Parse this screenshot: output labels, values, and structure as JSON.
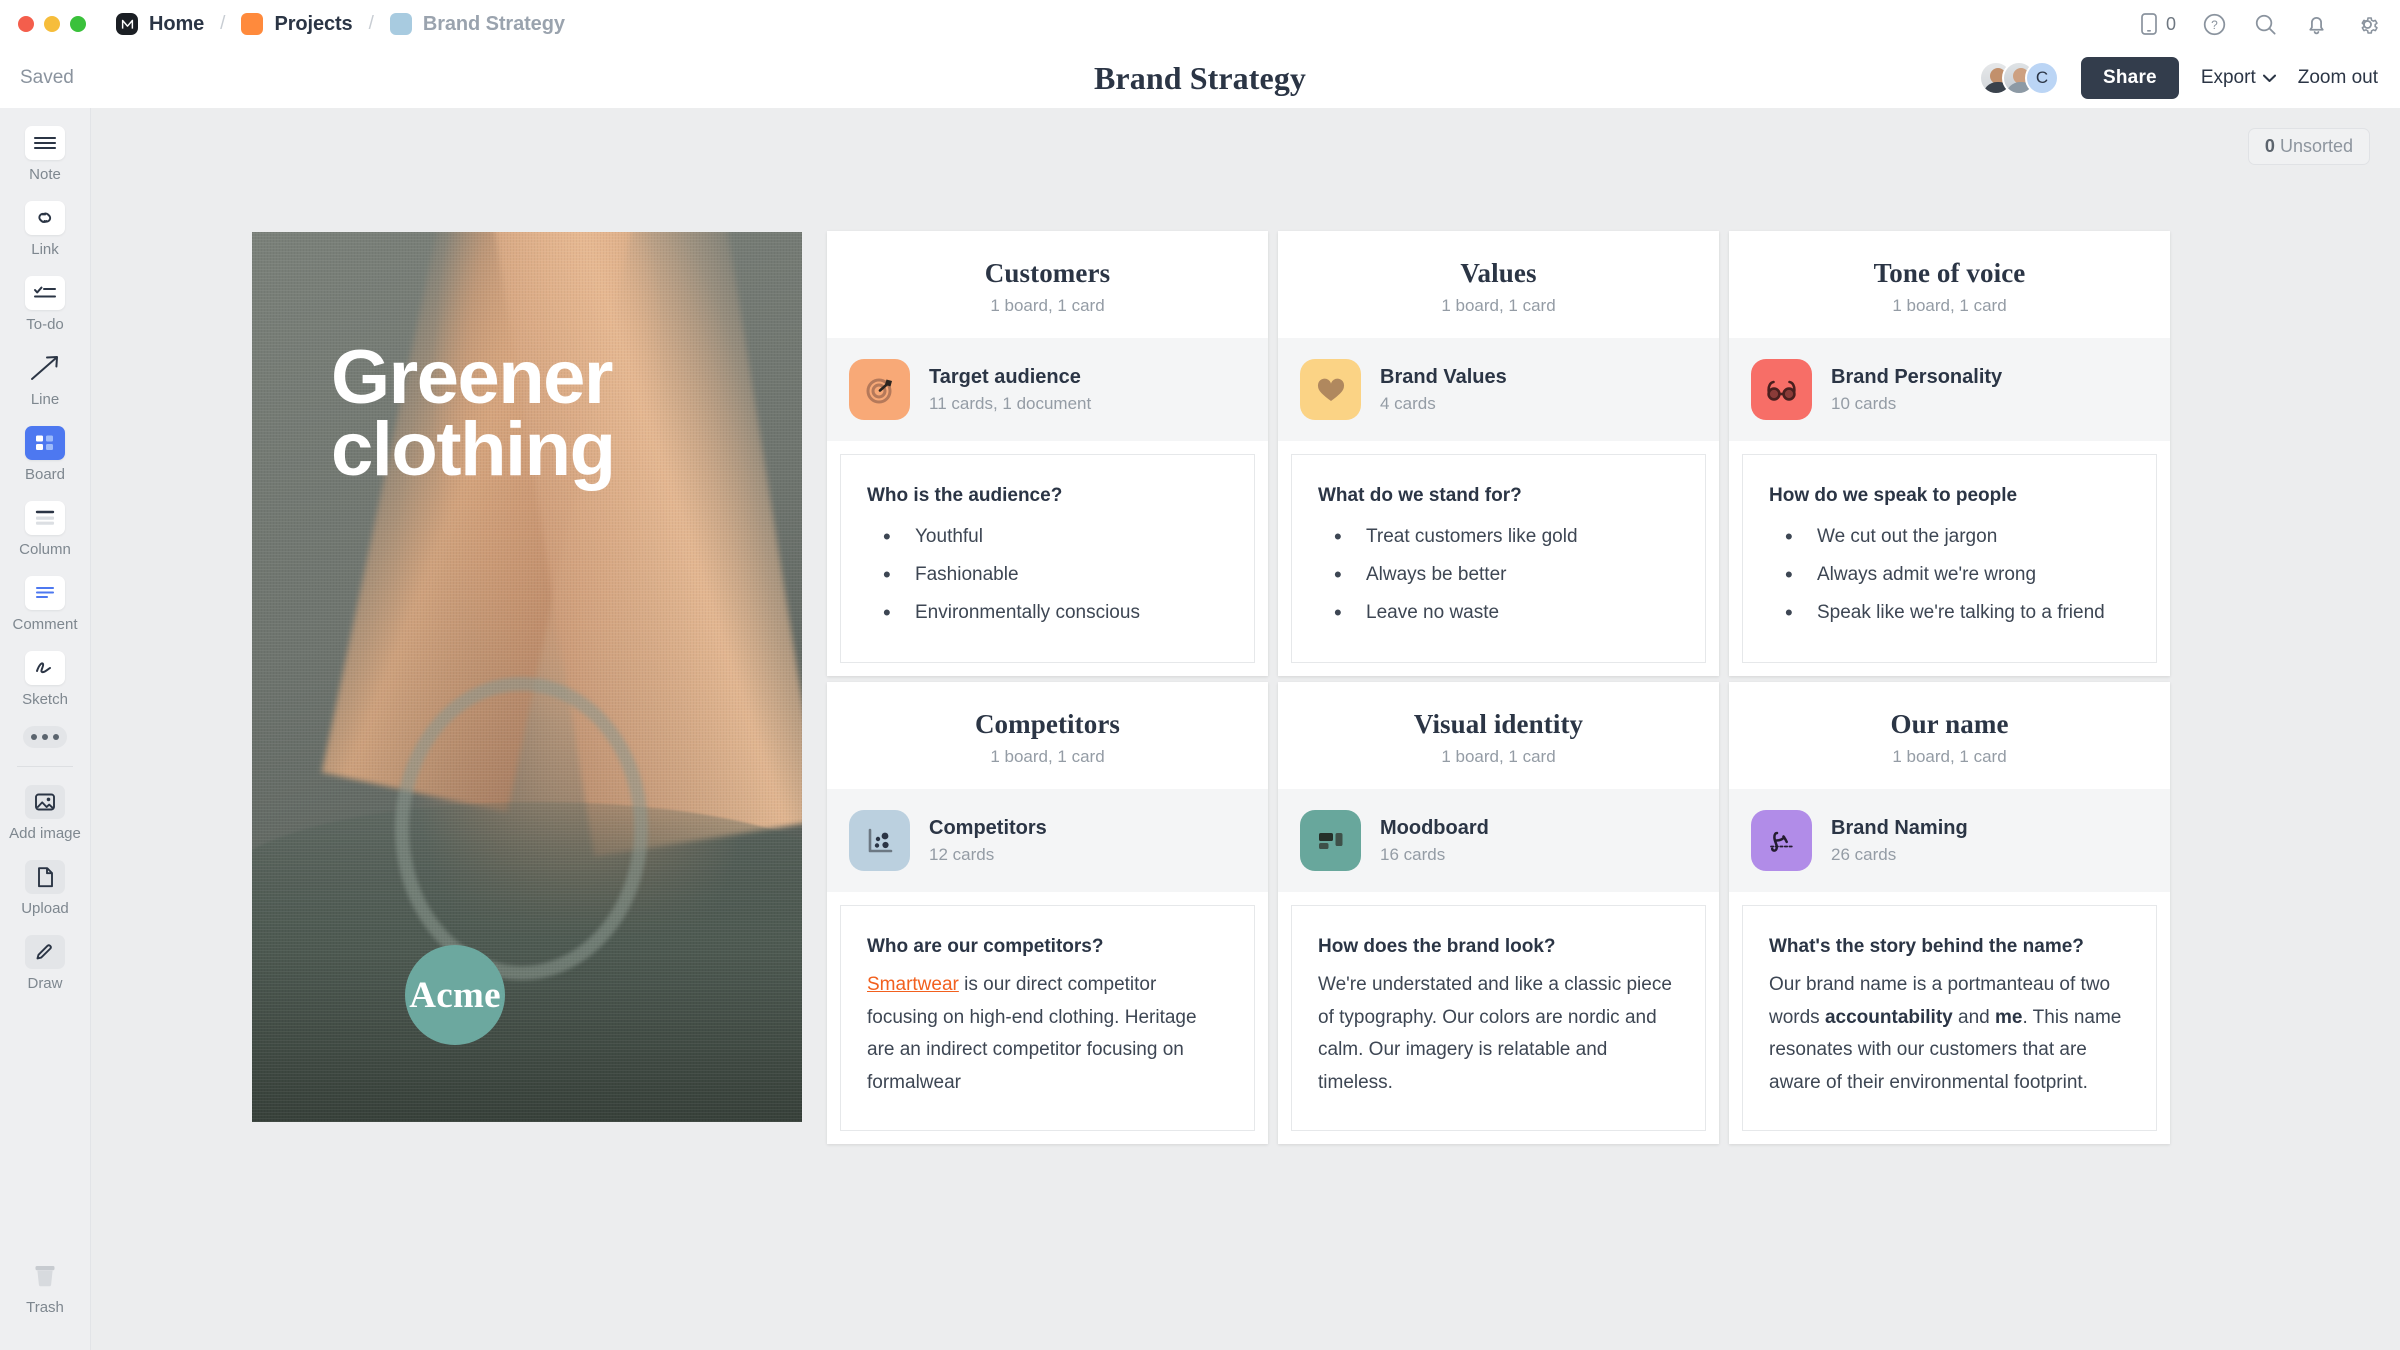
{
  "window": {
    "traffic_lights": [
      "close-red",
      "minimize-yellow",
      "maximize-green"
    ],
    "breadcrumb": [
      {
        "label": "Home",
        "icon": "milanote-logo-icon",
        "muted": false
      },
      {
        "label": "Projects",
        "icon": "orange-folder-icon",
        "muted": false
      },
      {
        "label": "Brand Strategy",
        "icon": "blue-board-icon",
        "muted": true
      }
    ],
    "separator": "/"
  },
  "topbar_icons": {
    "device_count": "0",
    "device": "mobile-device-icon",
    "help": "help-circle-icon",
    "search": "search-icon",
    "notifications": "bell-icon",
    "settings": "gear-icon"
  },
  "subbar": {
    "save_status": "Saved",
    "title": "Brand Strategy",
    "avatars": [
      "user-avatar-1",
      "user-avatar-2",
      "C"
    ],
    "share_label": "Share",
    "export_label": "Export",
    "export_caret": "chevron-down-icon",
    "zoom_label": "Zoom out"
  },
  "toolbar": {
    "items": [
      {
        "label": "Note",
        "icon": "note-icon",
        "style": "white"
      },
      {
        "label": "Link",
        "icon": "link-icon",
        "style": "white"
      },
      {
        "label": "To-do",
        "icon": "todo-icon",
        "style": "white"
      },
      {
        "label": "Line",
        "icon": "line-arrow-icon",
        "style": "plain"
      },
      {
        "label": "Board",
        "icon": "board-icon",
        "style": "active"
      },
      {
        "label": "Column",
        "icon": "column-icon",
        "style": "white"
      },
      {
        "label": "Comment",
        "icon": "comment-icon",
        "style": "white"
      },
      {
        "label": "Sketch",
        "icon": "sketch-icon",
        "style": "white"
      }
    ],
    "more": "more-dots-icon",
    "secondary": [
      {
        "label": "Add image",
        "icon": "add-image-icon"
      },
      {
        "label": "Upload",
        "icon": "upload-file-icon"
      },
      {
        "label": "Draw",
        "icon": "draw-pencil-icon"
      }
    ],
    "trash": {
      "label": "Trash",
      "icon": "trash-icon"
    }
  },
  "canvas": {
    "unsorted_count": "0",
    "unsorted_label": "Unsorted"
  },
  "hero": {
    "headline_line1": "Greener",
    "headline_line2": "clothing",
    "badge": "Acme",
    "badge_color": "#6CA89F"
  },
  "cards": [
    {
      "title": "Customers",
      "subtitle": "1 board, 1 card",
      "board": {
        "name": "Target audience",
        "meta": "11 cards, 1 document",
        "icon": "target-dartboard-icon",
        "color": "#F8A977"
      },
      "note": {
        "heading": "Who is the audience?",
        "type": "list",
        "items": [
          "Youthful",
          "Fashionable",
          "Environmentally conscious"
        ]
      }
    },
    {
      "title": "Values",
      "subtitle": "1 board, 1 card",
      "board": {
        "name": "Brand Values",
        "meta": "4 cards",
        "icon": "heart-icon",
        "color": "#FBD385"
      },
      "note": {
        "heading": "What do we stand for?",
        "type": "list",
        "items": [
          "Treat customers like gold",
          "Always be better",
          "Leave no waste"
        ]
      }
    },
    {
      "title": "Tone of voice",
      "subtitle": "1 board, 1 card",
      "board": {
        "name": "Brand Personality",
        "meta": "10 cards",
        "icon": "glasses-icon",
        "color": "#F76E67"
      },
      "note": {
        "heading": "How do we speak to people",
        "type": "list",
        "items": [
          "We cut out the jargon",
          "Always admit we're wrong",
          "Speak like we're talking to a friend"
        ]
      }
    },
    {
      "title": "Competitors",
      "subtitle": "1 board, 1 card",
      "board": {
        "name": "Competitors",
        "meta": "12 cards",
        "icon": "scatter-plot-icon",
        "color": "#BBD0DF"
      },
      "note": {
        "heading": "Who are our competitors?",
        "type": "paragraph",
        "link_text": "Smartwear",
        "body": " is our direct competitor focusing on high-end clothing. Heritage are an indirect competitor focusing on formalwear"
      }
    },
    {
      "title": "Visual identity",
      "subtitle": "1 board, 1 card",
      "board": {
        "name": "Moodboard",
        "meta": "16 cards",
        "icon": "moodboard-layout-icon",
        "color": "#68A79C"
      },
      "note": {
        "heading": "How does the brand look?",
        "type": "paragraph",
        "body": "We're understated and like a classic piece of typography. Our colors are nordic and calm. Our imagery is relatable and timeless."
      }
    },
    {
      "title": "Our name",
      "subtitle": "1 board, 1 card",
      "board": {
        "name": "Brand Naming",
        "meta": "26 cards",
        "icon": "signature-icon",
        "color": "#B18CE8"
      },
      "note": {
        "heading": "What's the story behind the name?",
        "type": "rich",
        "parts": [
          {
            "text": "Our brand name is a portmanteau of two words ",
            "bold": false
          },
          {
            "text": "accountability",
            "bold": true
          },
          {
            "text": " and ",
            "bold": false
          },
          {
            "text": "me",
            "bold": true
          },
          {
            "text": ". This name resonates with our customers that are aware of their environmental footprint.",
            "bold": false
          }
        ]
      }
    }
  ],
  "colors": {
    "canvas_bg": "#ECEDEE",
    "accent_blue": "#4D78F0",
    "share_dark": "#333D4C",
    "link_orange": "#F2601E",
    "title_navy": "#2B3545"
  }
}
